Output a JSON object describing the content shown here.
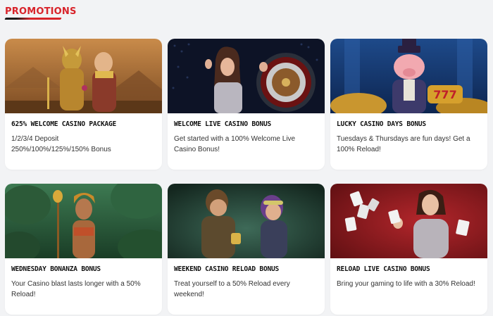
{
  "page": {
    "title": "PROMOTIONS"
  },
  "promotions": [
    {
      "title": "625% WELCOME CASINO PACKAGE",
      "desc_line1": "1/2/3/4 Deposit",
      "desc_line2": "250%/100%/125%/150% Bonus",
      "image": "egyptian-queens-artwork"
    },
    {
      "title": "WELCOME LIVE CASINO BONUS",
      "desc": "Get started with a 100% Welcome Live Casino Bonus!",
      "image": "live-dealer-roulette-photo"
    },
    {
      "title": "LUCKY CASINO DAYS BONUS",
      "desc": "Tuesdays & Thursdays are fun days! Get a 100% Reload!",
      "image": "pig-slot-777-artwork"
    },
    {
      "title": "WEDNESDAY BONANZA BONUS",
      "desc": "Your Casino blast lasts longer with a 50% Reload!",
      "image": "jungle-warrior-artwork"
    },
    {
      "title": "WEEKEND CASINO RELOAD BONUS",
      "desc": "Treat yourself to a 50% Reload every weekend!",
      "image": "adventurers-cave-artwork"
    },
    {
      "title": "RELOAD LIVE CASINO BONUS",
      "desc": "Bring your gaming to life with a 30% Reload!",
      "image": "woman-with-cards-photo"
    }
  ],
  "colors": {
    "accent": "#d8232a",
    "background": "#f2f3f5",
    "card": "#ffffff"
  }
}
